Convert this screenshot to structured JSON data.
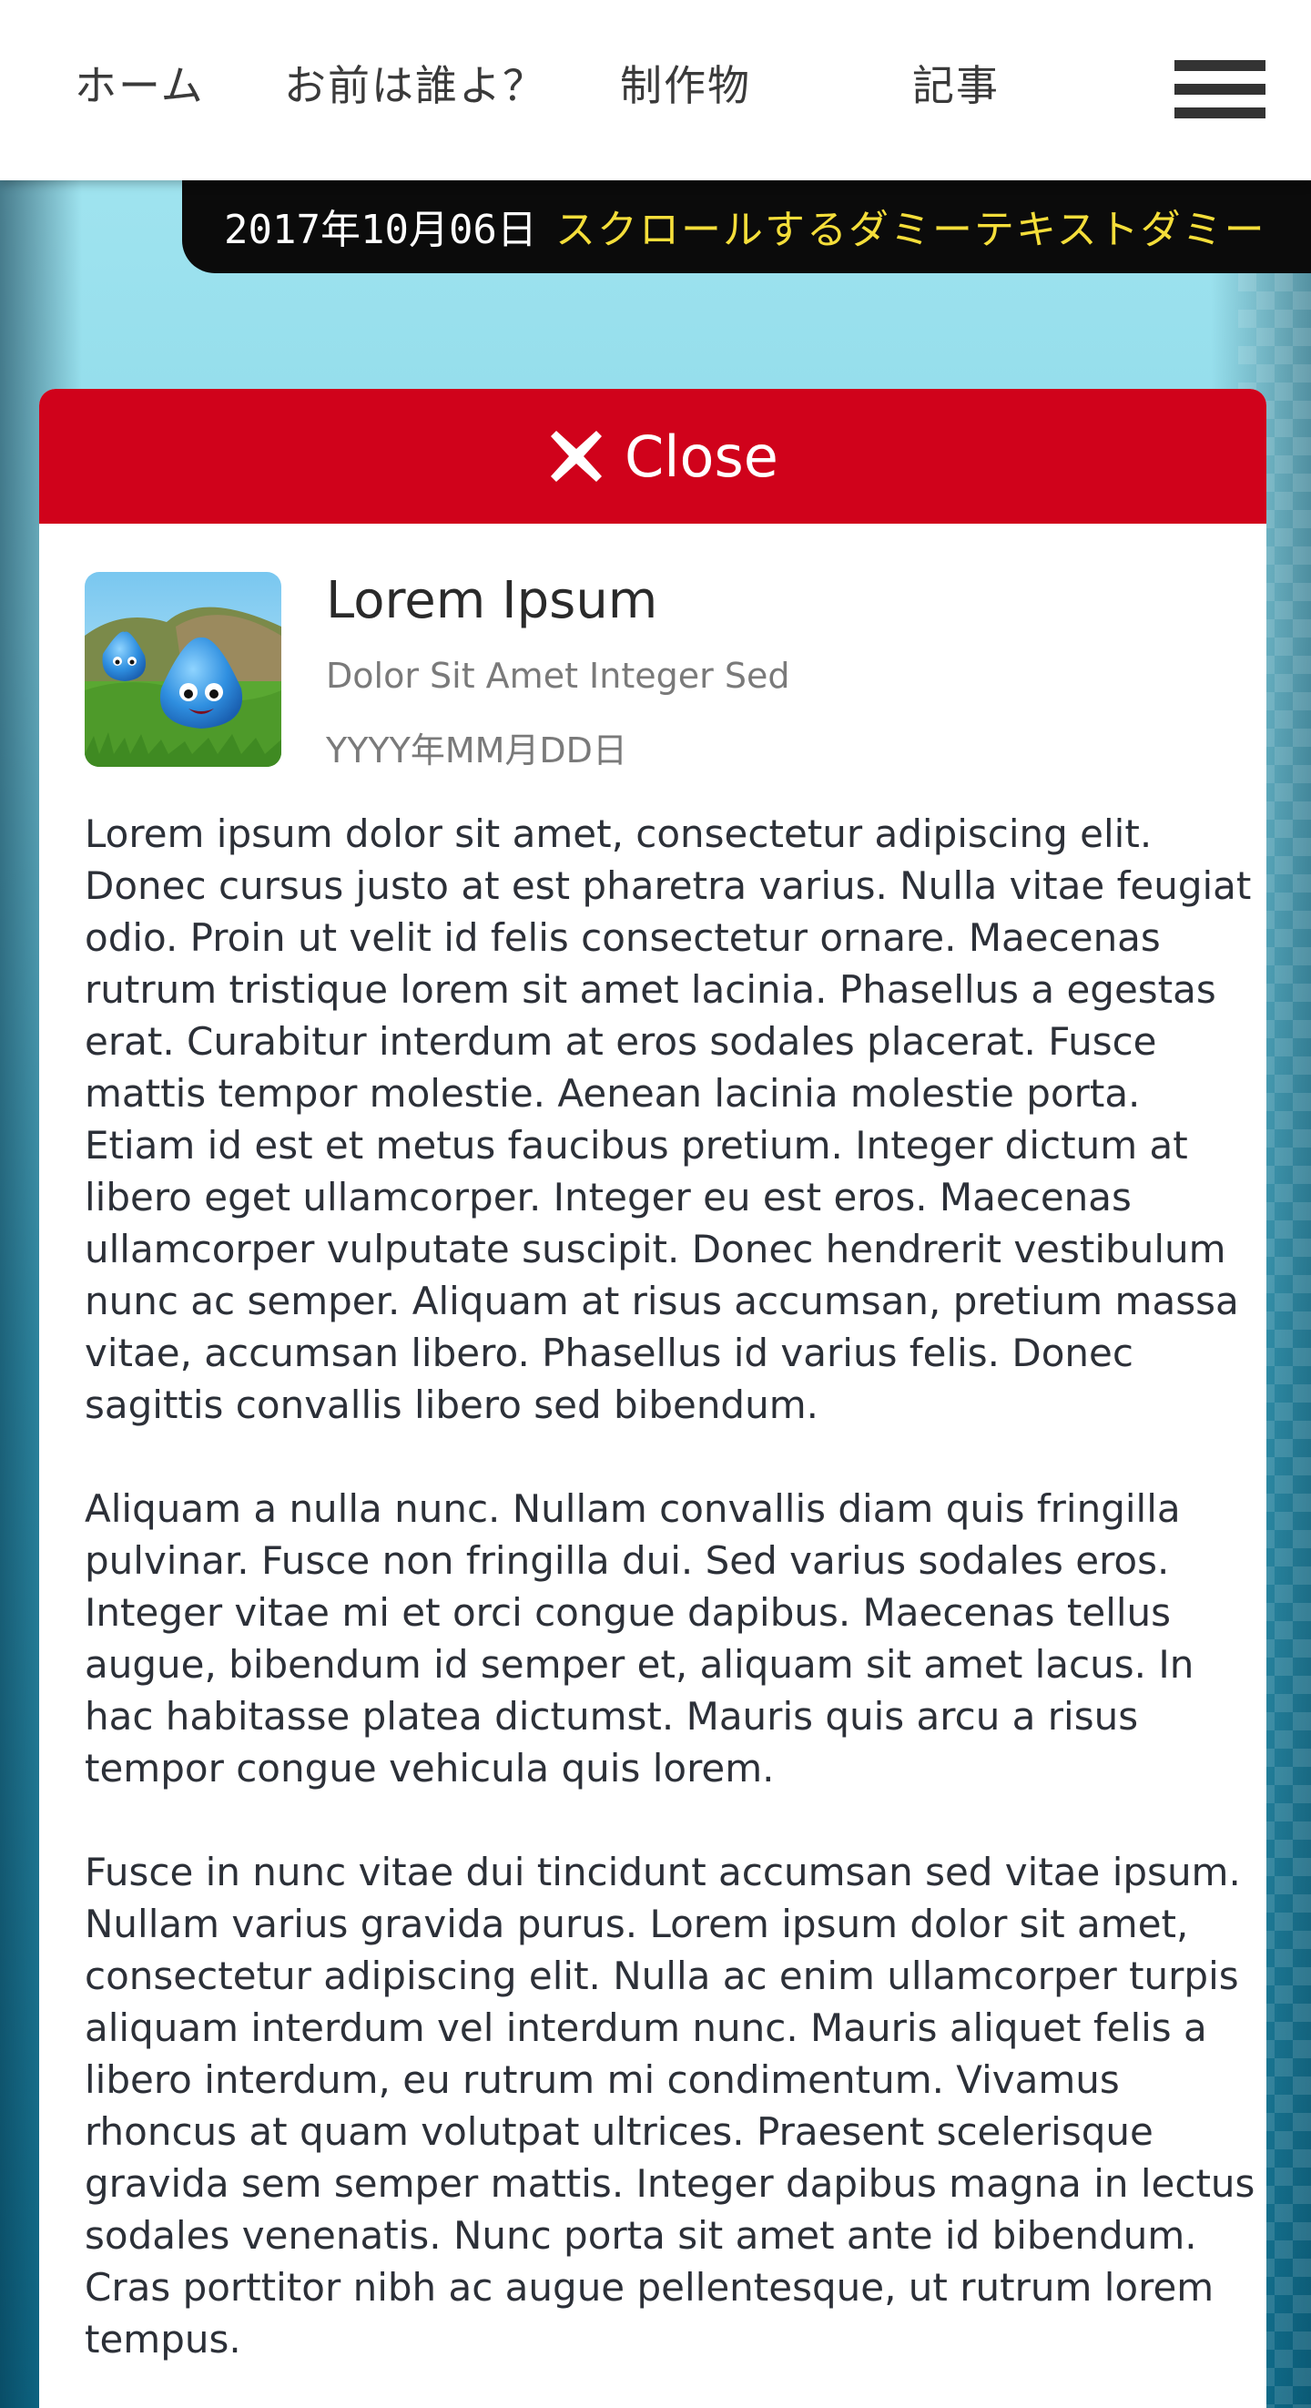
{
  "nav": {
    "items": [
      {
        "label": "ホーム"
      },
      {
        "label": "お前は誰よ？"
      },
      {
        "label": "制作物"
      },
      {
        "label": "記事"
      }
    ],
    "menu_icon": "hamburger-menu-icon"
  },
  "ticker": {
    "date": "2017年10月06日",
    "text": "スクロールするダミーテキストダミー"
  },
  "modal": {
    "close_label": "Close",
    "close_icon": "close-x-icon",
    "accent_color": "#d0021b",
    "app": {
      "title": "Lorem Ipsum",
      "subtitle": "Dolor Sit Amet Integer Sed",
      "date": "YYYY年MM月DD日",
      "icon": "slime-app-icon"
    },
    "paragraphs": [
      "Lorem ipsum dolor sit amet, consectetur adipiscing elit. Donec cursus justo at est pharetra varius. Nulla vitae feugiat odio. Proin ut velit id felis consectetur ornare. Maecenas rutrum tristique lorem sit amet lacinia. Phasellus a egestas erat. Curabitur interdum at eros sodales placerat. Fusce mattis tempor molestie. Aenean lacinia molestie porta. Etiam id est et metus faucibus pretium. Integer dictum at libero eget ullamcorper. Integer eu est eros. Maecenas ullamcorper vulputate suscipit. Donec hendrerit vestibulum nunc ac semper. Aliquam at risus accumsan, pretium massa vitae, accumsan libero. Phasellus id varius felis. Donec sagittis convallis libero sed bibendum.",
      "Aliquam a nulla nunc. Nullam convallis diam quis fringilla pulvinar. Fusce non fringilla dui. Sed varius sodales eros. Integer vitae mi et orci congue dapibus. Maecenas tellus augue, bibendum id semper et, aliquam sit amet lacus. In hac habitasse platea dictumst. Mauris quis arcu a risus tempor congue vehicula quis lorem.",
      "Fusce in nunc vitae dui tincidunt accumsan sed vitae ipsum. Nullam varius gravida purus. Lorem ipsum dolor sit amet, consectetur adipiscing elit. Nulla ac enim ullamcorper turpis aliquam interdum vel interdum nunc. Mauris aliquet felis a libero interdum, eu rutrum mi condimentum. Vivamus rhoncus at quam volutpat ultrices. Praesent scelerisque gravida sem semper mattis. Integer dapibus magna in lectus sodales venenatis. Nunc porta sit amet ante id bibendum. Cras porttitor nibh ac augue pellentesque, ut rutrum lorem tempus."
    ]
  }
}
